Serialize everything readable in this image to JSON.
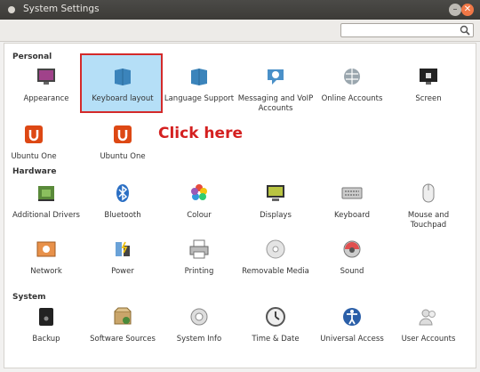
{
  "window": {
    "title": "System Settings"
  },
  "search": {
    "placeholder": ""
  },
  "sections": {
    "personal": "Personal",
    "hardware": "Hardware",
    "system": "System"
  },
  "items": {
    "appearance": "Appearance",
    "keyboard_layout": "Keyboard layout",
    "language_support": "Language Support",
    "messaging": "Messaging and VoIP Accounts",
    "online_accounts": "Online Accounts",
    "screen": "Screen",
    "ubuntu_one_1": "Ubuntu One",
    "ubuntu_one_2": "Ubuntu One",
    "additional_drivers": "Additional Drivers",
    "bluetooth": "Bluetooth",
    "colour": "Colour",
    "displays": "Displays",
    "keyboard": "Keyboard",
    "mouse": "Mouse and Touchpad",
    "network": "Network",
    "power": "Power",
    "printing": "Printing",
    "removable_media": "Removable Media",
    "sound": "Sound",
    "backup": "Backup",
    "software_sources": "Software Sources",
    "system_info": "System Info",
    "time_date": "Time & Date",
    "universal_access": "Universal Access",
    "user_accounts": "User Accounts"
  },
  "annotation": "Click here"
}
